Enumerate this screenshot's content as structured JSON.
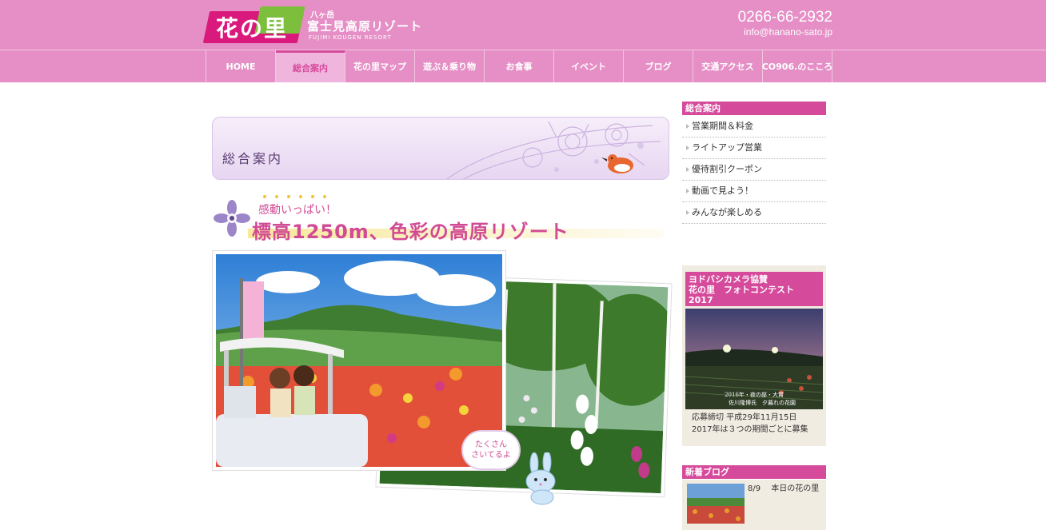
{
  "header": {
    "logo_main": "花の里",
    "logo_small": "八ヶ岳",
    "logo_name": "富士見高原リゾート",
    "logo_en": "FUJIMI KOUGEN RESORT",
    "phone": "0266-66-2932",
    "email": "info@hanano-sato.jp"
  },
  "nav": {
    "items": [
      {
        "label": "HOME"
      },
      {
        "label": "総合案内"
      },
      {
        "label": "花の里マップ"
      },
      {
        "label": "遊ぶ＆乗り物"
      },
      {
        "label": "お食事"
      },
      {
        "label": "イベント"
      },
      {
        "label": "ブログ"
      },
      {
        "label": "交通アクセス"
      },
      {
        "label": "CO906.のこころ"
      }
    ],
    "active_index": 1
  },
  "main": {
    "banner_title": "総合案内",
    "headline_sub": "感動いっぱい！",
    "headline_main": "標高1250m、色彩の高原リゾート",
    "bubble_text": "たくさん\nさいてるよ"
  },
  "sidebar": {
    "section_title": "総合案内",
    "items": [
      {
        "label": "営業期間＆料金"
      },
      {
        "label": "ライトアップ営業"
      },
      {
        "label": "優待割引クーポン"
      },
      {
        "label": "動画で見よう！"
      },
      {
        "label": "みんなが楽しめる"
      }
    ],
    "contest": {
      "title_line1": "ヨドバシカメラ協賛",
      "title_line2": "花の里　フォトコンテスト",
      "title_line3": "2017",
      "photo_caption_line1": "2016年・夜の部・大賞",
      "photo_caption_line2": "佐川隆博氏　夕暮れの花園",
      "text_line1": "応募締切 平成29年11月15日",
      "text_line2": "2017年は３つの期間ごとに募集"
    },
    "blog": {
      "title": "新着ブログ",
      "date": "8/9",
      "entry": "本日の花の里"
    }
  },
  "colors": {
    "header_bg": "#e58fc6",
    "accent": "#d64a9c",
    "sidebar_box_bg": "#f1ece1"
  }
}
